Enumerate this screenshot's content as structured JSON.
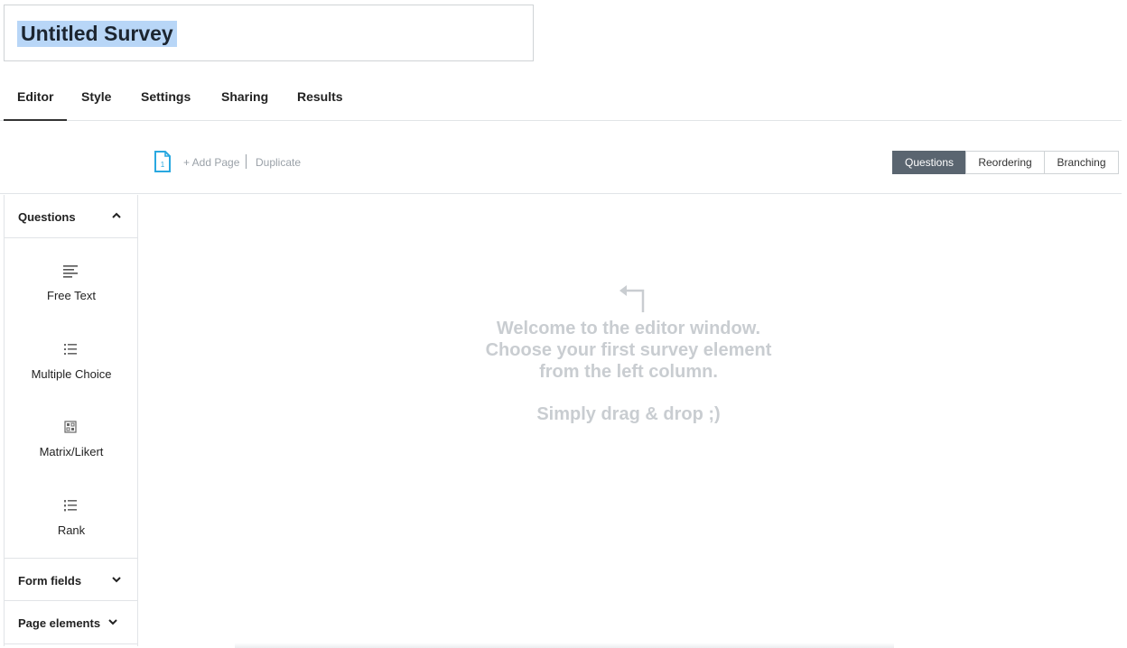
{
  "survey": {
    "title": "Untitled Survey"
  },
  "tabs": [
    "Editor",
    "Style",
    "Settings",
    "Sharing",
    "Results"
  ],
  "active_tab": "Editor",
  "page_bar": {
    "page_number": "1",
    "add_page": "+ Add Page",
    "duplicate": "Duplicate",
    "view_modes": [
      "Questions",
      "Reordering",
      "Branching"
    ],
    "active_mode": "Questions"
  },
  "sidebar": {
    "questions_header": "Questions",
    "question_types": [
      {
        "label": "Free Text",
        "icon": "text-lines-icon"
      },
      {
        "label": "Multiple Choice",
        "icon": "list-icon"
      },
      {
        "label": "Matrix/Likert",
        "icon": "matrix-icon"
      },
      {
        "label": "Rank",
        "icon": "rank-list-icon"
      }
    ],
    "form_fields_header": "Form fields",
    "page_elements_header": "Page elements"
  },
  "canvas": {
    "welcome_lines": [
      "Welcome to the editor window.",
      "Choose your first survey element",
      "from the left column."
    ],
    "hint": "Simply drag & drop ;)"
  },
  "colors": {
    "title_highlight": "#b8d6f7",
    "active_segment": "#5a6570",
    "page_icon": "#29a8e0",
    "welcome_text": "#c9cdd1"
  }
}
